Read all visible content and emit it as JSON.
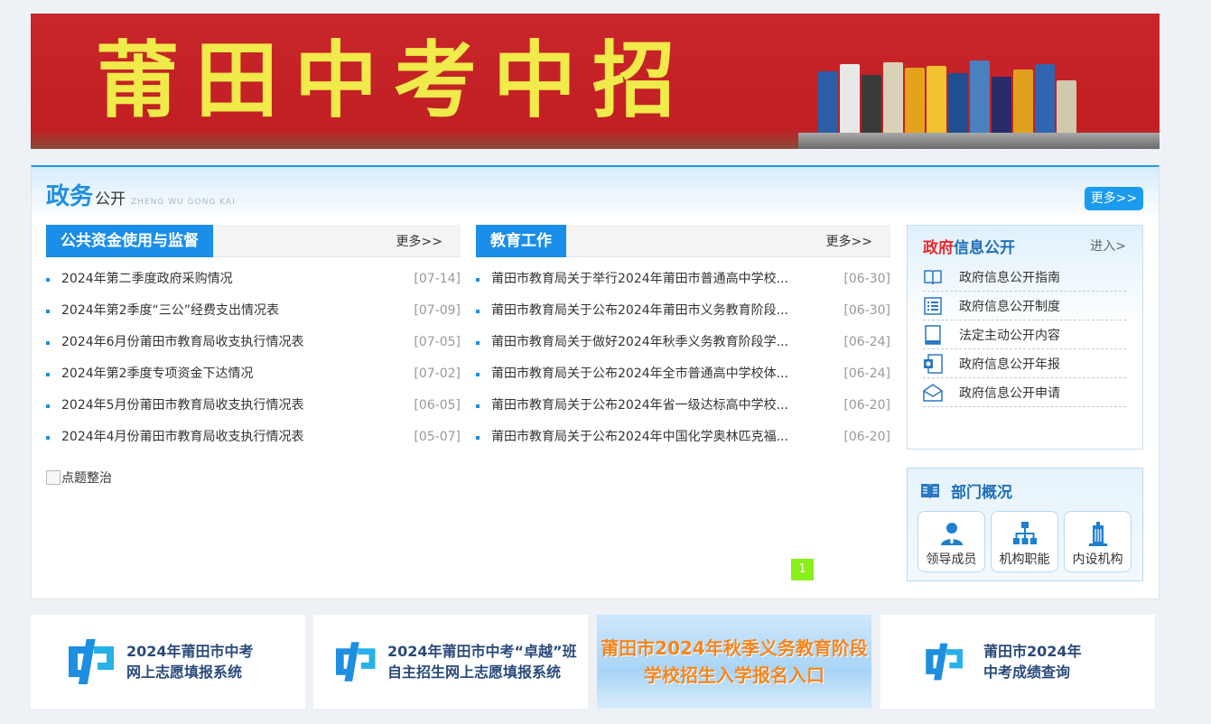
{
  "banner": {
    "title": "莆田中考中招"
  },
  "panel": {
    "title_main": "政务",
    "title_sub": "公开",
    "title_en": "ZHENG WU GONG KAI",
    "more": "更多>>"
  },
  "col1": {
    "tab": "公共资金使用与监督",
    "more": "更多>>",
    "items": [
      {
        "title": "2024年第二季度政府采购情况",
        "date": "[07-14]"
      },
      {
        "title": "2024年第2季度“三公”经费支出情况表",
        "date": "[07-09]"
      },
      {
        "title": "2024年6月份莆田市教育局收支执行情况表",
        "date": "[07-05]"
      },
      {
        "title": "2024年第2季度专项资金下达情况",
        "date": "[07-02]"
      },
      {
        "title": "2024年5月份莆田市教育局收支执行情况表",
        "date": "[06-05]"
      },
      {
        "title": "2024年4月份莆田市教育局收支执行情况表",
        "date": "[05-07]"
      }
    ]
  },
  "col2": {
    "tab": "教育工作",
    "more": "更多>>",
    "items": [
      {
        "title": "莆田市教育局关于举行2024年莆田市普通高中学校...",
        "date": "[06-30]"
      },
      {
        "title": "莆田市教育局关于公布2024年莆田市义务教育阶段...",
        "date": "[06-30]"
      },
      {
        "title": "莆田市教育局关于做好2024年秋季义务教育阶段学...",
        "date": "[06-24]"
      },
      {
        "title": "莆田市教育局关于公布2024年全市普通高中学校体...",
        "date": "[06-24]"
      },
      {
        "title": "莆田市教育局关于公布2024年省一级达标高中学校...",
        "date": "[06-20]"
      },
      {
        "title": "莆田市教育局关于公布2024年中国化学奥林匹克福...",
        "date": "[06-20]"
      }
    ]
  },
  "broken_image_alt": "点题整治",
  "pager": {
    "current": "1"
  },
  "gov": {
    "title_red": "政府",
    "title_blue": "信息公开",
    "enter": "进入>",
    "items": [
      {
        "label": "政府信息公开指南",
        "icon": "book-icon"
      },
      {
        "label": "政府信息公开制度",
        "icon": "list-icon"
      },
      {
        "label": "法定主动公开内容",
        "icon": "document-icon"
      },
      {
        "label": "政府信息公开年报",
        "icon": "report-icon"
      },
      {
        "label": "政府信息公开申请",
        "icon": "envelope-icon"
      }
    ]
  },
  "dept": {
    "title": "部门概况",
    "items": [
      {
        "label": "领导成员",
        "icon": "person-icon"
      },
      {
        "label": "机构职能",
        "icon": "org-chart-icon"
      },
      {
        "label": "内设机构",
        "icon": "building-icon"
      }
    ]
  },
  "links": [
    {
      "line1": "2024年莆田市中考",
      "line2": "网上志愿填报系统"
    },
    {
      "line1": "2024年莆田市中考“卓越”班",
      "line2": "自主招生网上志愿填报系统"
    },
    {
      "line1": "莆田市2024年秋季义务教育阶段",
      "line2": "学校招生入学报名入口"
    },
    {
      "line1": "莆田市2024年",
      "line2": "中考成绩查询"
    }
  ],
  "colors": {
    "accent": "#1a8ee8",
    "banner_red": "#c8262a",
    "banner_text": "#f0ea4a",
    "pager_green": "#8af019"
  }
}
